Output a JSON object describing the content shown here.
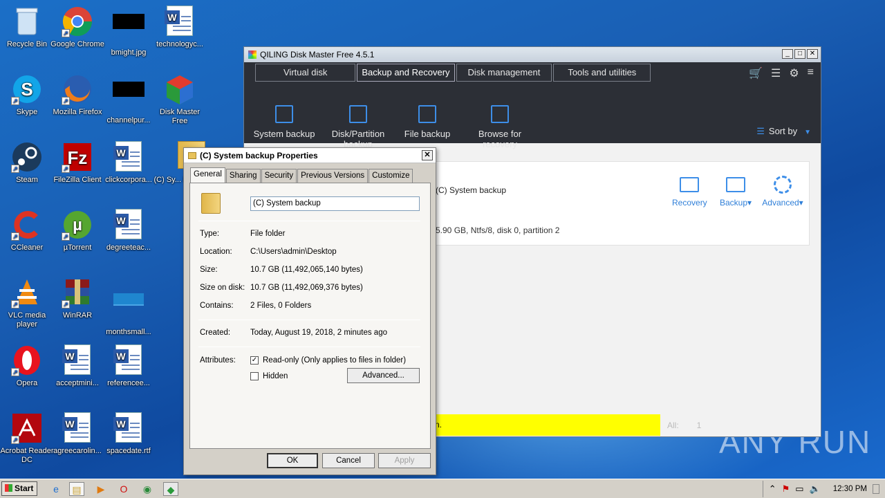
{
  "desktop_icons": [
    {
      "label": "Recycle Bin",
      "icon": "recycle-bin-icon"
    },
    {
      "label": "Google Chrome",
      "icon": "chrome-icon"
    },
    {
      "label": "bmight.jpg",
      "icon": "image-file-icon"
    },
    {
      "label": "technologyc...",
      "icon": "word-doc-icon"
    },
    {
      "label": "Skype",
      "icon": "skype-icon"
    },
    {
      "label": "Mozilla Firefox",
      "icon": "firefox-icon"
    },
    {
      "label": "channelpur...",
      "icon": "image-file-icon"
    },
    {
      "label": "Disk Master Free",
      "icon": "disk-master-icon"
    },
    {
      "label": "Steam",
      "icon": "steam-icon"
    },
    {
      "label": "FileZilla Client",
      "icon": "filezilla-icon"
    },
    {
      "label": "clickcorpora...",
      "icon": "word-doc-icon"
    },
    {
      "label": "(C) Sy... back...",
      "icon": "folder-icon"
    },
    {
      "label": "CCleaner",
      "icon": "ccleaner-icon"
    },
    {
      "label": "µTorrent",
      "icon": "utorrent-icon"
    },
    {
      "label": "degreeteac...",
      "icon": "word-doc-icon"
    },
    {
      "label": "VLC media player",
      "icon": "vlc-icon"
    },
    {
      "label": "WinRAR",
      "icon": "winrar-icon"
    },
    {
      "label": "monthsmall...",
      "icon": "image-file-icon"
    },
    {
      "label": "Opera",
      "icon": "opera-icon"
    },
    {
      "label": "acceptmini...",
      "icon": "word-doc-icon"
    },
    {
      "label": "referencee...",
      "icon": "word-doc-icon"
    },
    {
      "label": "Acrobat Reader DC",
      "icon": "acrobat-icon"
    },
    {
      "label": "agreecarolin...",
      "icon": "word-doc-icon"
    },
    {
      "label": "spacedate.rtf",
      "icon": "word-doc-icon"
    }
  ],
  "qiling": {
    "title": "QILING Disk Master Free 4.5.1",
    "tabs": [
      "Virtual disk",
      "Backup and Recovery",
      "Disk management",
      "Tools and utilities"
    ],
    "features": [
      "System backup",
      "Disk/Partition backup",
      "File backup",
      "Browse for recovery"
    ],
    "sort_by": "Sort by",
    "card_name": "(C) System backup",
    "card_info": "5.90 GB, Ntfs/8, disk 0, partition 2",
    "actions": [
      "Recovery",
      "Backup▾",
      "Advanced▾"
    ],
    "status_text": "n.",
    "all_label": "All:",
    "all_count": "1"
  },
  "props": {
    "title": "(C) System backup Properties",
    "tabs": [
      "General",
      "Sharing",
      "Security",
      "Previous Versions",
      "Customize"
    ],
    "name_value": "(C) System backup",
    "type_k": "Type:",
    "type_v": "File folder",
    "loc_k": "Location:",
    "loc_v": "C:\\Users\\admin\\Desktop",
    "size_k": "Size:",
    "size_v": "10.7 GB (11,492,065,140 bytes)",
    "sod_k": "Size on disk:",
    "sod_v": "10.7 GB (11,492,069,376 bytes)",
    "cont_k": "Contains:",
    "cont_v": "2 Files, 0 Folders",
    "created_k": "Created:",
    "created_v": "Today, August 19, 2018, 2 minutes ago",
    "attr_k": "Attributes:",
    "readonly": "Read-only (Only applies to files in folder)",
    "hidden": "Hidden",
    "advanced": "Advanced...",
    "ok": "OK",
    "cancel": "Cancel",
    "apply": "Apply"
  },
  "taskbar": {
    "start": "Start",
    "clock": "12:30 PM"
  },
  "watermark": "ANY RUN"
}
